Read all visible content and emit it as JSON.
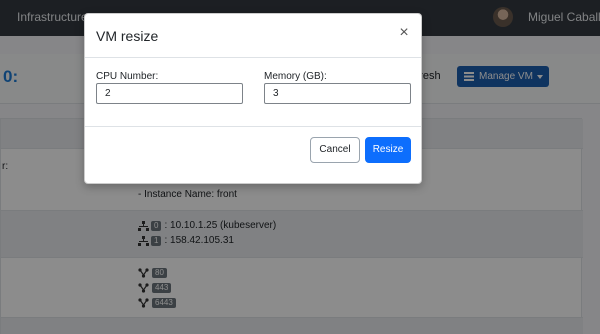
{
  "topbar": {
    "brand": "Infrastructures",
    "user_name": "Miguel Caballe"
  },
  "page_header": {
    "vm_title": "0:",
    "refresh_label": "efresh",
    "manage_label": "Manage VM"
  },
  "table": {
    "rows": [
      {
        "key": "r:",
        "val": ""
      },
      {
        "key": "",
        "val": "- Instance Name: front"
      },
      {
        "key": "",
        "val": ""
      },
      {
        "key": "",
        "val": ""
      },
      {
        "key": "",
        "val": ""
      }
    ],
    "networks": [
      {
        "index": "0",
        "text": ": 10.10.1.25 (kubeserver)"
      },
      {
        "index": "1",
        "text": ": 158.42.105.31"
      }
    ],
    "ports": [
      "80",
      "443",
      "6443"
    ]
  },
  "modal": {
    "title": "VM resize",
    "close_symbol": "×",
    "cpu": {
      "label": "CPU Number:",
      "value": "2"
    },
    "memory": {
      "label": "Memory (GB):",
      "value": "3"
    },
    "cancel_label": "Cancel",
    "resize_label": "Resize"
  },
  "colors": {
    "primary": "#0d6efd",
    "manage_button": "#1c5fb0",
    "title_blue": "#1c7bd6",
    "topbar": "#343a40"
  }
}
